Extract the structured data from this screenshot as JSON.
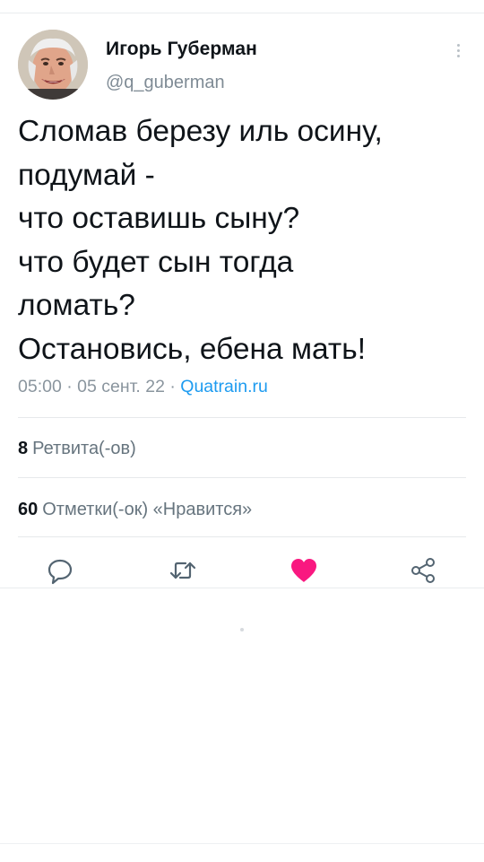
{
  "author": {
    "name": "Игорь Губерман",
    "handle": "@q_guberman"
  },
  "tweet": {
    "text": "Сломав березу иль осину,\nподумай -\nчто оставишь сыну?\nчто будет сын тогда\nломать?\nОстановись, ебена мать!",
    "time": "05:00",
    "date": "05 сент. 22",
    "separator": "·",
    "source": "Quatrain.ru"
  },
  "stats": {
    "retweets_count": "8",
    "retweets_label": "Ретвита(-ов)",
    "likes_count": "60",
    "likes_label": "Отметки(-ок) «Нравится»"
  },
  "actions": {
    "reply_icon": "reply-icon",
    "retweet_icon": "retweet-icon",
    "like_icon": "heart-icon",
    "share_icon": "share-icon",
    "liked": true
  },
  "colors": {
    "accent": "#1d9bf0",
    "like": "#f91880",
    "muted": "#8a959e"
  }
}
